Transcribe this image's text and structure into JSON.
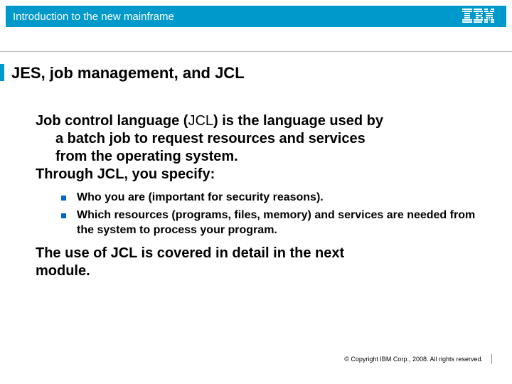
{
  "header": {
    "title": "Introduction to the new mainframe"
  },
  "slide": {
    "title": "JES, job management, and JCL",
    "para1_lead": "Job control language (",
    "para1_jcl": "JCL",
    "para1_tail": ") is the language used by",
    "para1_line2": "a batch job to request resources and services",
    "para1_line3": "from the operating system.",
    "para1_line4": "Through JCL, you specify:",
    "bullets": [
      "Who you are (important for security reasons).",
      "Which resources (programs, files, memory) and services are needed from the system to process your program."
    ],
    "para2_line1": "The use of JCL is covered in detail in the next",
    "para2_line2": "module."
  },
  "footer": {
    "copyright": "© Copyright IBM Corp., 2008. All rights reserved."
  }
}
